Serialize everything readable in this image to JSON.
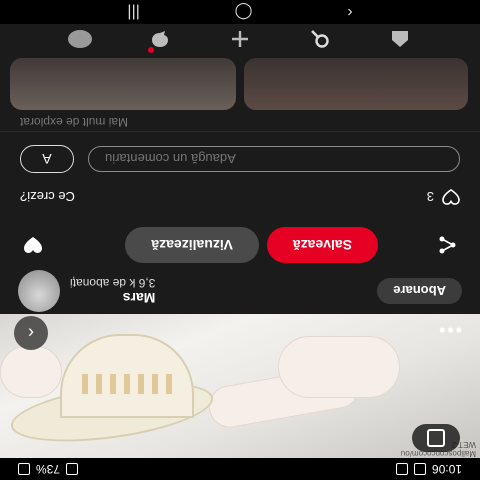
{
  "status": {
    "time": "10:06",
    "battery": "73%"
  },
  "photo": {
    "watermark_line1": "Maliposconcocom/ou",
    "watermark_line2": "WET-2"
  },
  "profile": {
    "name": "Mars",
    "followers": "3,6 k de abonați",
    "follow_label": "Abonare"
  },
  "actions": {
    "view_label": "Vizualizează",
    "save_label": "Salvează"
  },
  "comments": {
    "title": "Ce crezi?",
    "likes": "3",
    "input_placeholder": "Adaugă un comentariu",
    "user_initial": "A"
  },
  "explore": {
    "label": "Mai mult de explorat"
  },
  "icons": {
    "share": "share-icon",
    "reaction": "heart-icon",
    "nav": [
      "home-icon",
      "search-icon",
      "plus-icon",
      "chat-icon",
      "profile-icon"
    ]
  }
}
